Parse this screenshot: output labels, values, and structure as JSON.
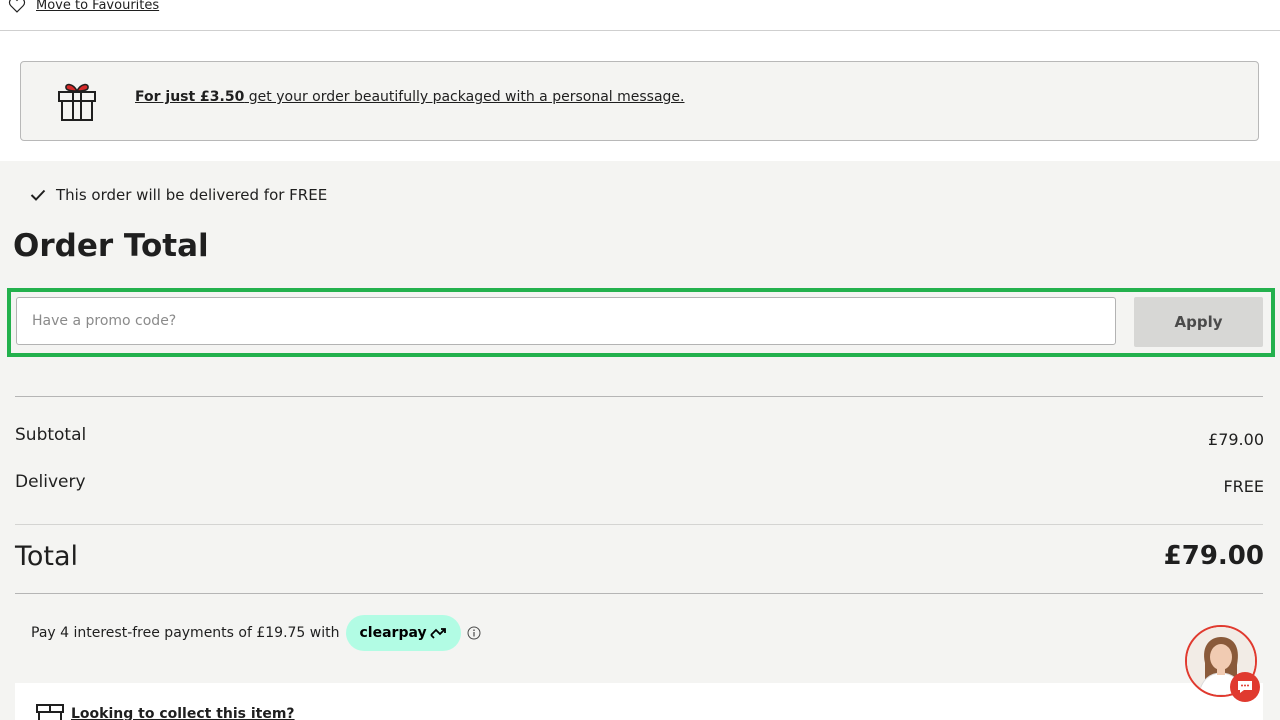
{
  "top": {
    "move_to_favourites": "Move to Favourites"
  },
  "gift": {
    "price_text": "For just £3.50",
    "rest_text": " get your order beautifully packaged with a personal message."
  },
  "delivery_note": "This order will be delivered for FREE",
  "order_title": "Order Total",
  "promo": {
    "placeholder": "Have a promo code?",
    "apply_label": "Apply"
  },
  "summary": {
    "subtotal_label": "Subtotal",
    "subtotal_value": "£79.00",
    "delivery_label": "Delivery",
    "delivery_value": "FREE",
    "total_label": "Total",
    "total_value": "£79.00"
  },
  "clearpay": {
    "text": "Pay 4 interest-free payments of £19.75 with",
    "brand": "clearpay"
  },
  "collect": {
    "text": "Looking to collect this item?"
  },
  "colors": {
    "highlight": "#23b14d",
    "clearpay_badge": "#b2fce4",
    "chat_accent": "#e03a2f",
    "gift_ribbon": "#d62a2a"
  }
}
